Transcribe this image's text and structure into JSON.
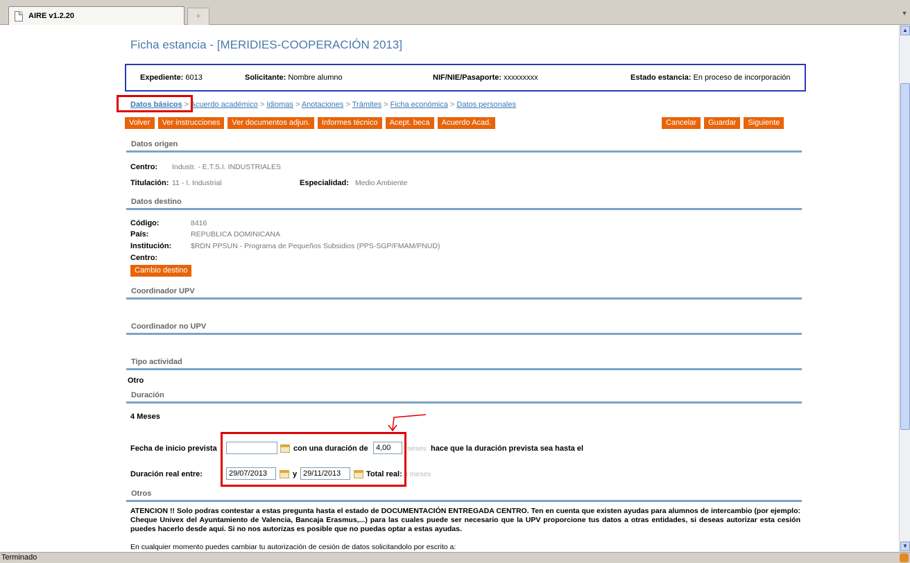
{
  "browser": {
    "tab_title": "AIRE v1.2.20",
    "new_tab": "+",
    "status": "Terminado"
  },
  "page": {
    "title": "Ficha estancia - [MERIDIES-COOPERACIÓN 2013]",
    "info": {
      "expediente_label": "Expediente:",
      "expediente_value": "6013",
      "solicitante_label": "Solicitante:",
      "solicitante_value": "Nombre alumno",
      "nif_label": "NIF/NIE/Pasaporte:",
      "nif_value": "xxxxxxxxx",
      "estado_label": "Estado estancia:",
      "estado_value": "En proceso de incorporación"
    },
    "breadcrumb": {
      "current": "Datos básicos",
      "sep": ">",
      "items": [
        "Acuerdo académico",
        "Idiomas",
        "Anotaciones",
        "Trámites",
        "Ficha económica",
        "Datos personales"
      ]
    },
    "buttons_left": [
      "Volver",
      "Ver instrucciones",
      "Ver documentos adjun.",
      "Informes técnico",
      "Acept. beca",
      "Acuerdo Acad."
    ],
    "buttons_right": [
      "Cancelar",
      "Guardar",
      "Siguiente"
    ],
    "origen": {
      "section": "Datos origen",
      "centro_label": "Centro:",
      "centro_value": "Industr. - E.T.S.I. INDUSTRIALES",
      "titulacion_label": "Titulación:",
      "titulacion_value": "11 - I. Industrial",
      "especialidad_label": "Especialidad:",
      "especialidad_value": "Medio Ambiente"
    },
    "destino": {
      "section": "Datos destino",
      "codigo_label": "Código:",
      "codigo_value": "8416",
      "pais_label": "País:",
      "pais_value": "REPUBLICA DOMINICANA",
      "institucion_label": "Institución:",
      "institucion_value": "$RDN PPSUN - Programa de Pequeños Subsidios (PPS-SGP/FMAM/PNUD)",
      "centro_label": "Centro:",
      "cambio_button": "Cambio destino"
    },
    "coord_upv": "Coordinador UPV",
    "coord_no_upv": "Coordinador no UPV",
    "tipo": {
      "section": "Tipo actividad",
      "value": "Otro"
    },
    "duracion": {
      "section": "Duración",
      "value": "4 Meses",
      "inicio_label": "Fecha de inicio prevista",
      "inicio_value": "",
      "con_duracion": "con una duración de",
      "meses_input": "4,00",
      "meses_text": "meses",
      "hasta_text": "hace que la duración prevista sea hasta el",
      "real_label": "Duración real entre:",
      "real_from": "29/07/2013",
      "y": "y",
      "real_to": "29/11/2013",
      "total_label": "Total real:",
      "total_value": "4 meses"
    },
    "otros": {
      "section": "Otros",
      "atencion": "ATENCION !! Solo podras contestar a estas pregunta hasta el estado de DOCUMENTACIÓN ENTREGADA CENTRO. Ten en cuenta que existen ayudas para alumnos de intercambio (por ejemplo: Cheque Univex del Ayuntamiento de Valencia, Bancaja Erasmus,...) para las cuales puede ser necesario que la UPV proporcione tus datos a otras entidades, si deseas autorizar esta cesión puedes hacerlo desde aqui. Si no nos autorizas es posible que no puedas optar a estas ayudas.",
      "cualquier": "En cualquier momento puedes cambiar tu autorización de cesión de datos solicitandolo por escrito a:"
    }
  }
}
